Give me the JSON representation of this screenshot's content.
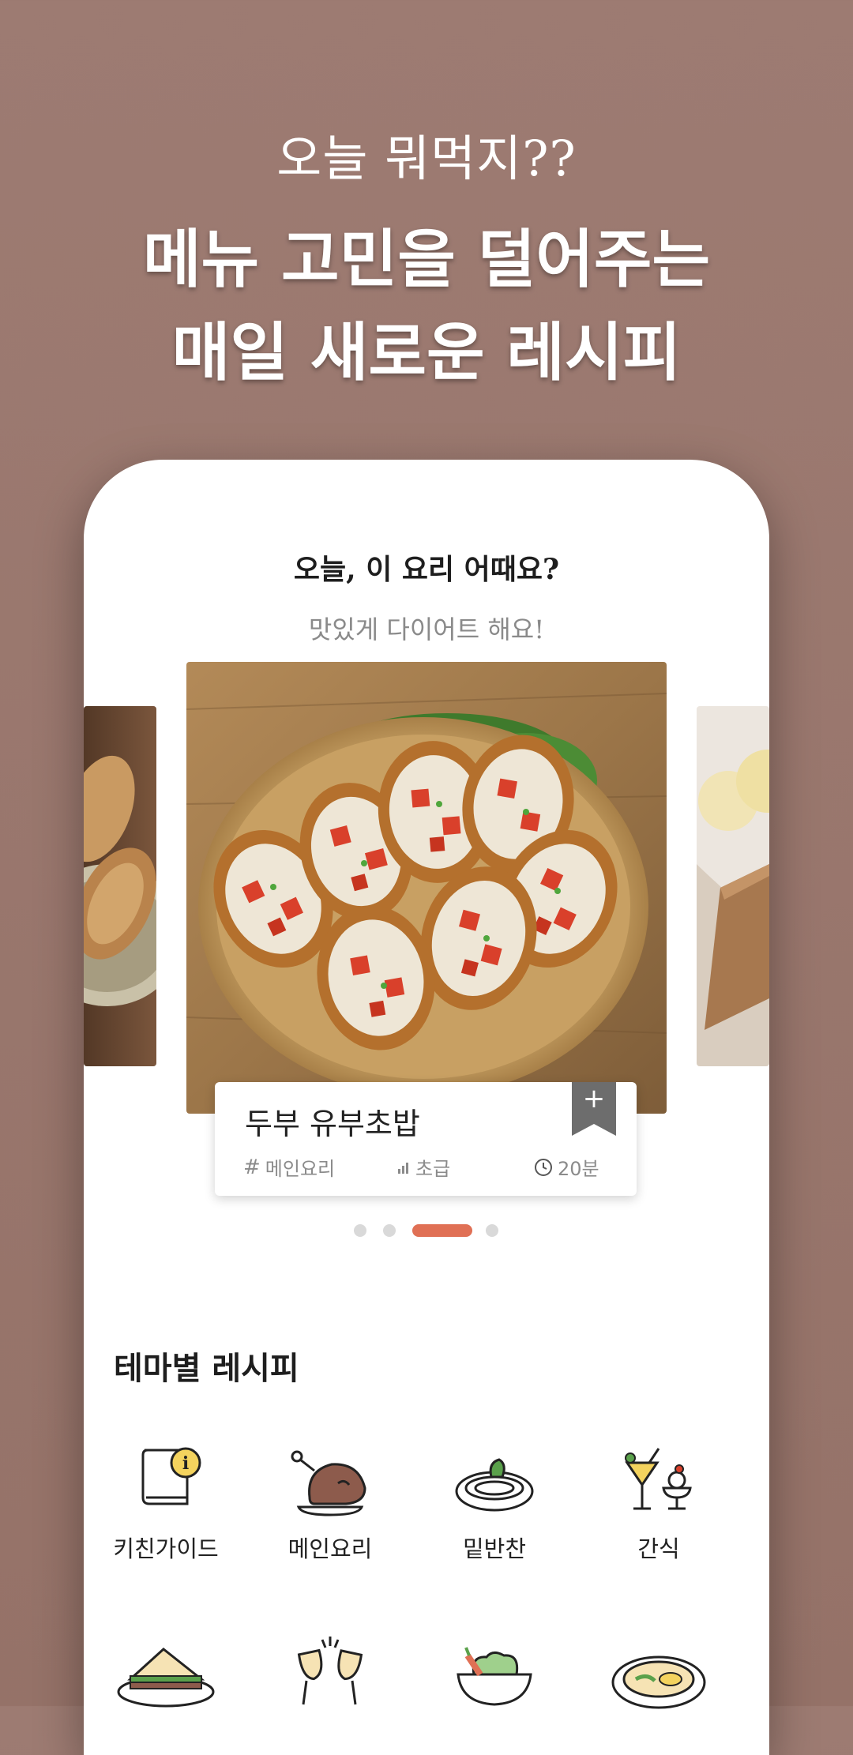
{
  "promo": {
    "top_line": "오늘 뭐먹지??",
    "title_line1": "메뉴 고민을 덜어주는",
    "title_line2": "매일 새로운 레시피"
  },
  "today": {
    "title": "오늘, 이 요리 어때요?",
    "subtitle": "맛있게 다이어트 해요!"
  },
  "recipe": {
    "name": "두부 유부초밥",
    "category": "메인요리",
    "difficulty": "초급",
    "time": "20분",
    "bookmark_icon": "+"
  },
  "carousel": {
    "page_count": 4,
    "active_index": 2
  },
  "themes": {
    "title": "테마별 레시피",
    "items": [
      {
        "label": "키친가이드",
        "icon": "guide-book-icon"
      },
      {
        "label": "메인요리",
        "icon": "roast-chicken-icon"
      },
      {
        "label": "밑반찬",
        "icon": "side-dish-icon"
      },
      {
        "label": "간식",
        "icon": "dessert-drink-icon"
      },
      {
        "label": "",
        "icon": "sandwich-icon"
      },
      {
        "label": "",
        "icon": "wine-toast-icon"
      },
      {
        "label": "",
        "icon": "salad-bowl-icon"
      },
      {
        "label": "",
        "icon": "soup-pot-icon"
      }
    ]
  },
  "colors": {
    "background": "#9d7b72",
    "accent": "#e07055",
    "icon_yellow": "#f4d35e",
    "icon_brown": "#8d5b4c"
  }
}
